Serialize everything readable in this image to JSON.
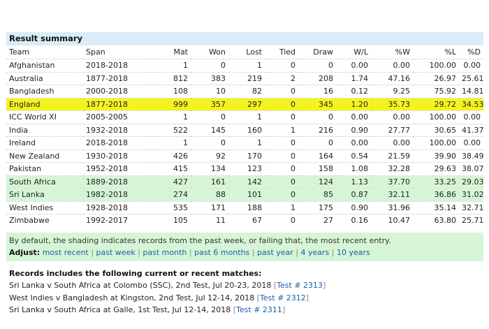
{
  "title": "Result summary",
  "columns": [
    "Team",
    "Span",
    "Mat",
    "Won",
    "Lost",
    "Tied",
    "Draw",
    "W/L",
    "%W",
    "%L",
    "%D"
  ],
  "rows": [
    {
      "team": "Afghanistan",
      "span": "2018-2018",
      "mat": "1",
      "won": "0",
      "lost": "1",
      "tied": "0",
      "draw": "0",
      "wl": "0.00",
      "pw": "0.00",
      "pl": "100.00",
      "pd": "0.00",
      "shade": ""
    },
    {
      "team": "Australia",
      "span": "1877-2018",
      "mat": "812",
      "won": "383",
      "lost": "219",
      "tied": "2",
      "draw": "208",
      "wl": "1.74",
      "pw": "47.16",
      "pl": "26.97",
      "pd": "25.61",
      "shade": ""
    },
    {
      "team": "Bangladesh",
      "span": "2000-2018",
      "mat": "108",
      "won": "10",
      "lost": "82",
      "tied": "0",
      "draw": "16",
      "wl": "0.12",
      "pw": "9.25",
      "pl": "75.92",
      "pd": "14.81",
      "shade": ""
    },
    {
      "team": "England",
      "span": "1877-2018",
      "mat": "999",
      "won": "357",
      "lost": "297",
      "tied": "0",
      "draw": "345",
      "wl": "1.20",
      "pw": "35.73",
      "pl": "29.72",
      "pd": "34.53",
      "shade": "highlight"
    },
    {
      "team": "ICC World XI",
      "span": "2005-2005",
      "mat": "1",
      "won": "0",
      "lost": "1",
      "tied": "0",
      "draw": "0",
      "wl": "0.00",
      "pw": "0.00",
      "pl": "100.00",
      "pd": "0.00",
      "shade": ""
    },
    {
      "team": "India",
      "span": "1932-2018",
      "mat": "522",
      "won": "145",
      "lost": "160",
      "tied": "1",
      "draw": "216",
      "wl": "0.90",
      "pw": "27.77",
      "pl": "30.65",
      "pd": "41.37",
      "shade": ""
    },
    {
      "team": "Ireland",
      "span": "2018-2018",
      "mat": "1",
      "won": "0",
      "lost": "1",
      "tied": "0",
      "draw": "0",
      "wl": "0.00",
      "pw": "0.00",
      "pl": "100.00",
      "pd": "0.00",
      "shade": ""
    },
    {
      "team": "New Zealand",
      "span": "1930-2018",
      "mat": "426",
      "won": "92",
      "lost": "170",
      "tied": "0",
      "draw": "164",
      "wl": "0.54",
      "pw": "21.59",
      "pl": "39.90",
      "pd": "38.49",
      "shade": ""
    },
    {
      "team": "Pakistan",
      "span": "1952-2018",
      "mat": "415",
      "won": "134",
      "lost": "123",
      "tied": "0",
      "draw": "158",
      "wl": "1.08",
      "pw": "32.28",
      "pl": "29.63",
      "pd": "38.07",
      "shade": ""
    },
    {
      "team": "South Africa",
      "span": "1889-2018",
      "mat": "427",
      "won": "161",
      "lost": "142",
      "tied": "0",
      "draw": "124",
      "wl": "1.13",
      "pw": "37.70",
      "pl": "33.25",
      "pd": "29.03",
      "shade": "green"
    },
    {
      "team": "Sri Lanka",
      "span": "1982-2018",
      "mat": "274",
      "won": "88",
      "lost": "101",
      "tied": "0",
      "draw": "85",
      "wl": "0.87",
      "pw": "32.11",
      "pl": "36.86",
      "pd": "31.02",
      "shade": "green"
    },
    {
      "team": "West Indies",
      "span": "1928-2018",
      "mat": "535",
      "won": "171",
      "lost": "188",
      "tied": "1",
      "draw": "175",
      "wl": "0.90",
      "pw": "31.96",
      "pl": "35.14",
      "pd": "32.71",
      "shade": ""
    },
    {
      "team": "Zimbabwe",
      "span": "1992-2017",
      "mat": "105",
      "won": "11",
      "lost": "67",
      "tied": "0",
      "draw": "27",
      "wl": "0.16",
      "pw": "10.47",
      "pl": "63.80",
      "pd": "25.71",
      "shade": ""
    }
  ],
  "note": {
    "text": "By default, the shading indicates records from the past week, or failing that, the most recent entry.",
    "adjust_label": "Adjust:",
    "links": [
      "most recent",
      "past week",
      "past month",
      "past 6 months",
      "past year",
      "4 years",
      "10 years"
    ],
    "separator": "|"
  },
  "records": {
    "header": "Records includes the following current or recent matches:",
    "items": [
      {
        "text": "Sri Lanka v South Africa at Colombo (SSC), 2nd Test, Jul 20-23, 2018",
        "link": "Test # 2313"
      },
      {
        "text": "West Indies v Bangladesh at Kingston, 2nd Test, Jul 12-14, 2018",
        "link": "Test # 2312"
      },
      {
        "text": "Sri Lanka v South Africa at Galle, 1st Test, Jul 12-14, 2018",
        "link": "Test # 2311"
      }
    ]
  },
  "colors": {
    "highlight": "#f5f31f",
    "green": "#d6f5d6",
    "title_bg": "#d9ecf7",
    "link": "#1a5fa8"
  }
}
